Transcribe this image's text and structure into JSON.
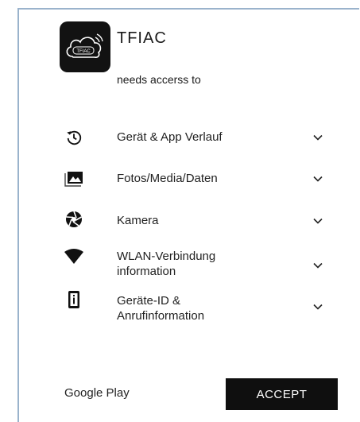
{
  "app": {
    "name": "TFIAC",
    "icon_text": "TFIAC",
    "subtitle": "needs accerss to"
  },
  "permissions": [
    {
      "icon": "history-icon",
      "label": "Gerät & App Verlauf"
    },
    {
      "icon": "photos-icon",
      "label": "Fotos/Media/Daten"
    },
    {
      "icon": "camera-aperture-icon",
      "label": "Kamera"
    },
    {
      "icon": "wifi-icon",
      "label": "WLAN-Verbindung\ninformation"
    },
    {
      "icon": "device-id-icon",
      "label": "Geräte-ID &\nAnrufinformation"
    }
  ],
  "footer": {
    "brand": "Google Play",
    "accept_label": "ACCEPT"
  },
  "colors": {
    "frame_border": "#9ab3cc",
    "app_icon_bg": "#121212",
    "accept_bg": "#0f0f0f",
    "accept_text": "#ffffff"
  }
}
